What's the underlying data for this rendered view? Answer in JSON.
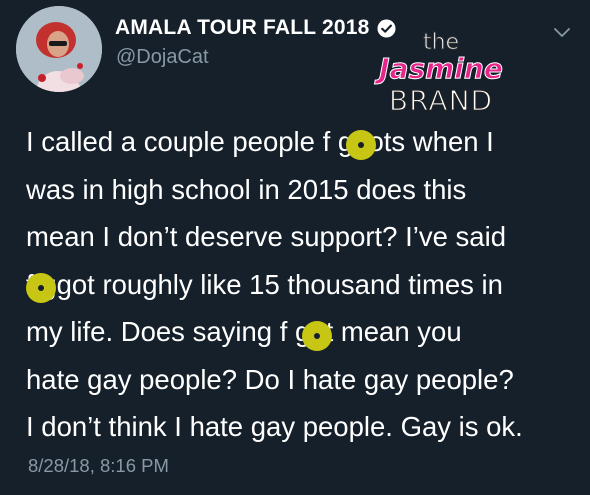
{
  "author": {
    "display_name": "AMALA TOUR FALL 2018",
    "handle": "@DojaCat",
    "verified": true
  },
  "watermark": {
    "line1": "the",
    "line2": "Jasmine",
    "line3": "BRAND"
  },
  "tweet": {
    "text": "I called a couple people f ggots when I\nwas in high school in 2015 does this\nmean I don’t deserve support? I’ve said\nf ggot roughly like 15 thousand times in\nmy life. Does saying f  got mean you\nhate gay people? Do I hate gay people?\nI don’t think I hate gay people. Gay is ok.",
    "timestamp": "8/28/18, 8:16 PM"
  },
  "colors": {
    "background": "#15202b",
    "secondary_text": "#8899a6",
    "censor_dot": "#c8c614",
    "watermark_accent": "#e6248a"
  },
  "icons": [
    "verified-badge-icon",
    "chevron-down-icon"
  ]
}
